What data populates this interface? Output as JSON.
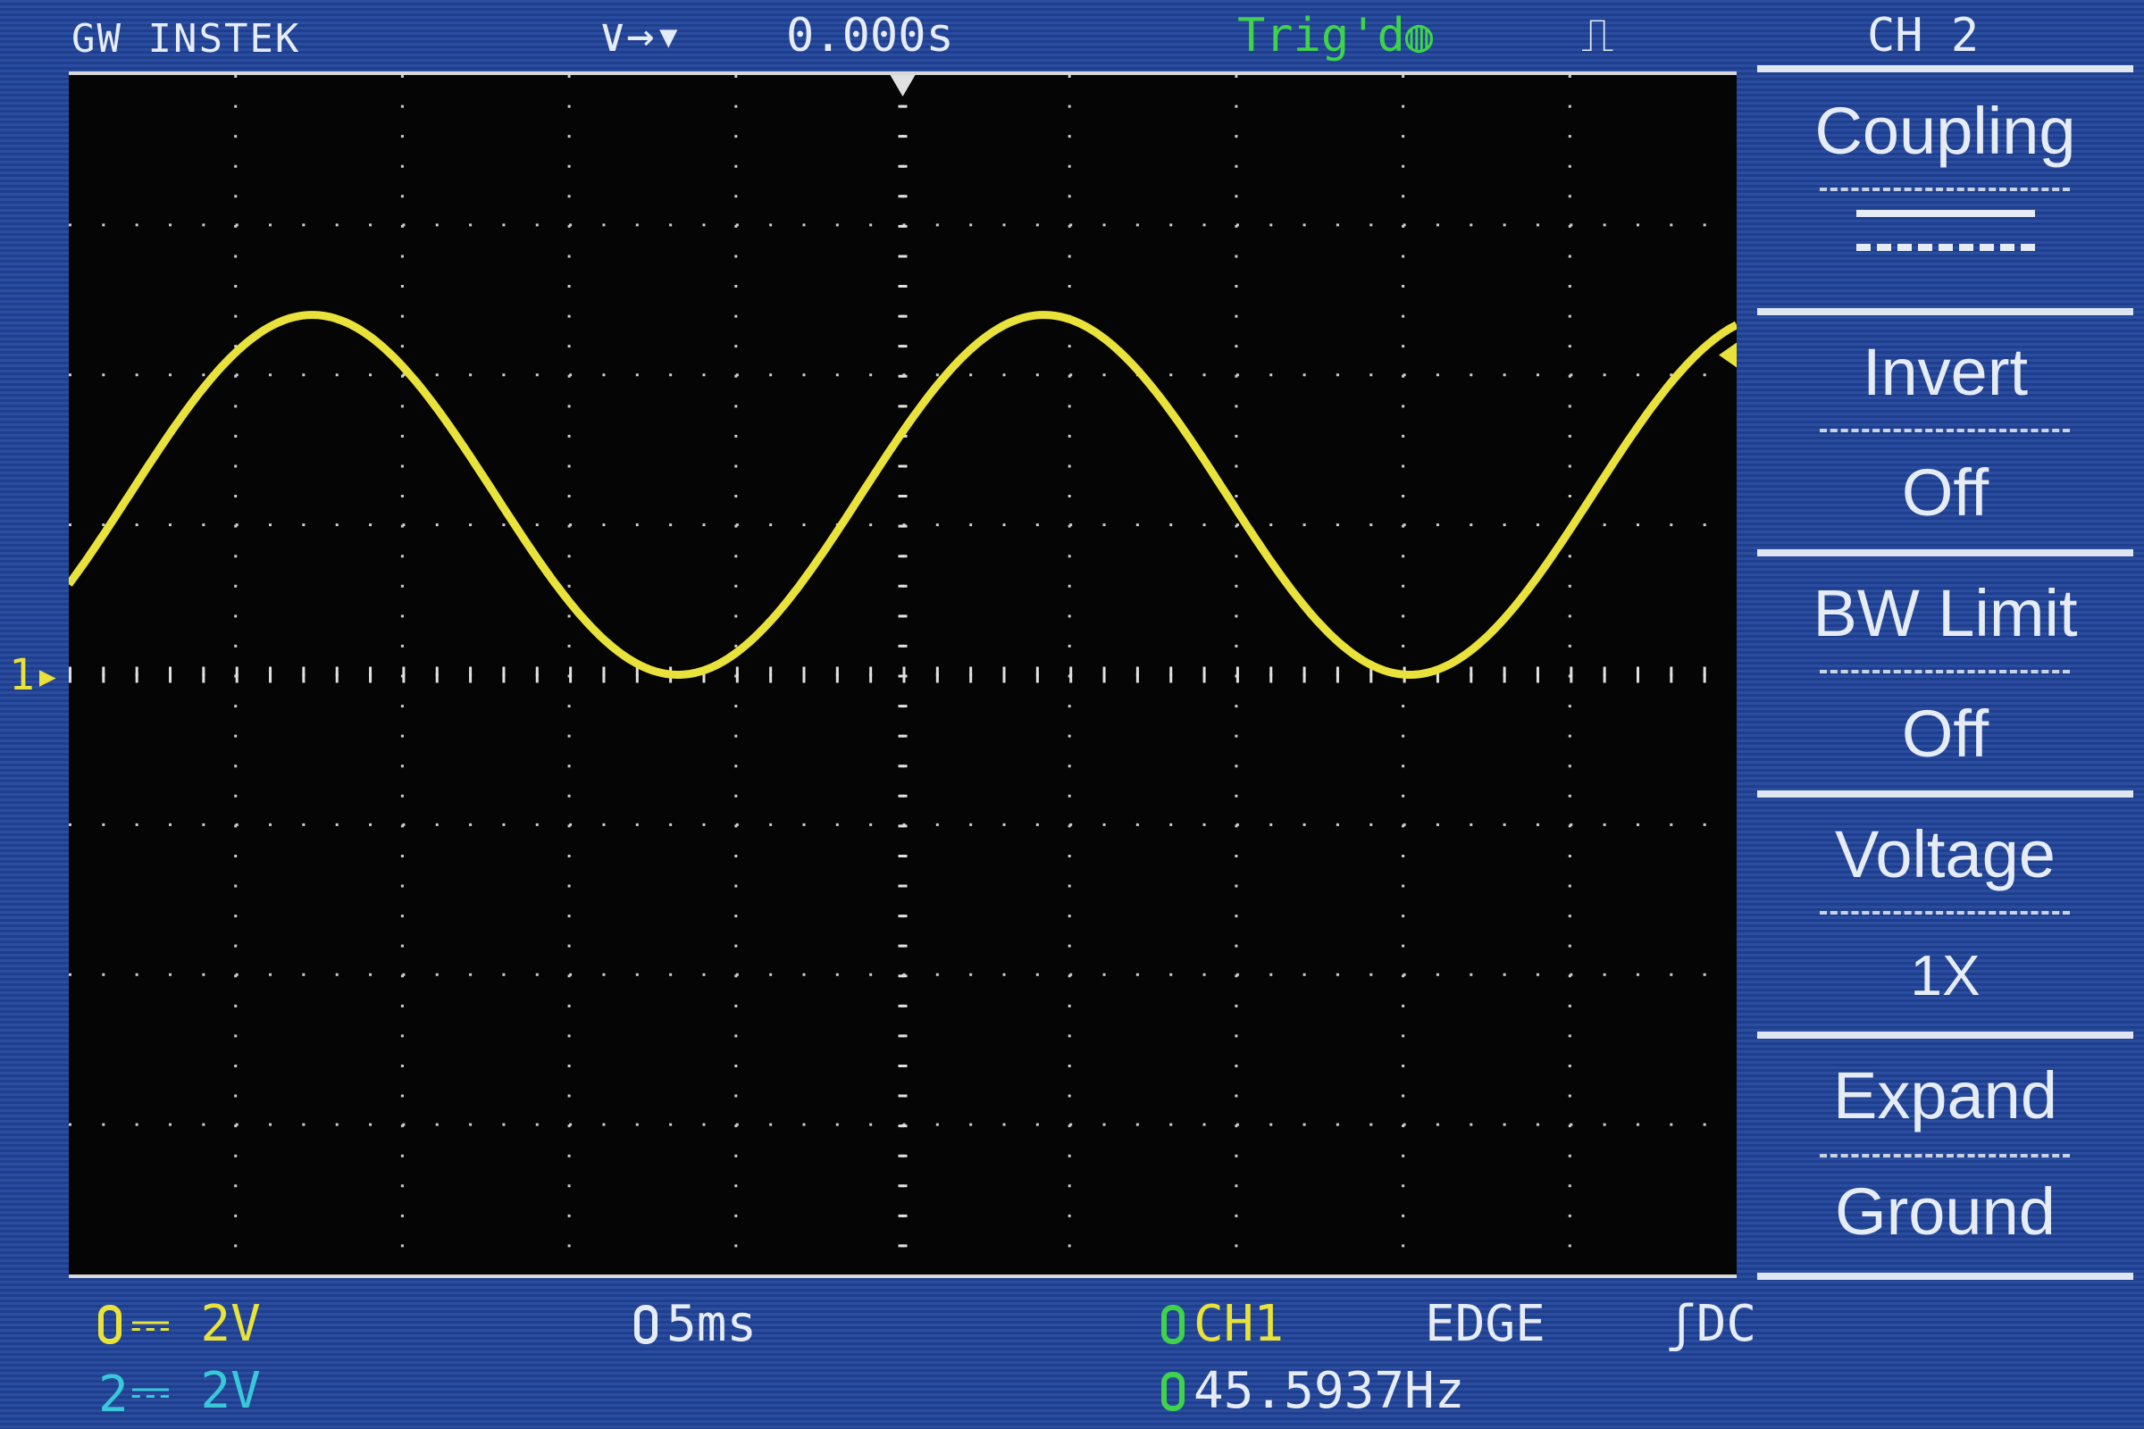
{
  "header": {
    "brand": "GW INSTEK",
    "timebase_position": "0.000s",
    "trigger_status": "Trig'd",
    "channel_title": "CH 2"
  },
  "menu": [
    {
      "label": "Coupling",
      "value": "DC"
    },
    {
      "label": "Invert",
      "value": "Off"
    },
    {
      "label": "BW Limit",
      "value": "Off"
    },
    {
      "label": "Voltage",
      "value": "1X"
    },
    {
      "label": "Expand",
      "value": "Ground"
    }
  ],
  "status": {
    "ch1_scale": "2V",
    "ch2_scale": "2V",
    "horizontal_scale": "5ms",
    "trigger_source": "CH1",
    "trigger_type": "EDGE",
    "trigger_coupling": "DC",
    "frequency": "45.5937Hz",
    "ch1_ground_marker": "1"
  },
  "colors": {
    "ch1": "#e8e23a",
    "ch2": "#38c8d8",
    "trigger": "#3fd24a",
    "background": "#2a4da0"
  },
  "chart_data": {
    "type": "line",
    "title": "CH1 waveform",
    "x_unit": "ms",
    "y_unit": "V",
    "xlim": [
      0,
      50
    ],
    "ylim": [
      -8,
      8
    ],
    "divisions": {
      "x": 10,
      "y": 8
    },
    "series": [
      {
        "name": "CH1",
        "waveform": "sine",
        "frequency_hz": 45.5937,
        "amplitude_v": 2.4,
        "offset_v": 2.4,
        "first_peak_ms": 7.3
      }
    ]
  }
}
